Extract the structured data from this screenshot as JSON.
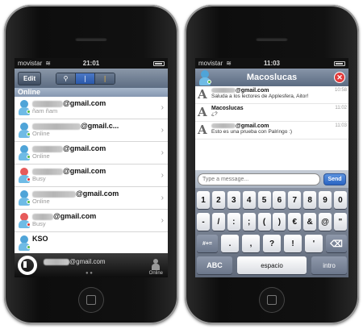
{
  "left": {
    "status": {
      "carrier": "movistar",
      "time": "21:01"
    },
    "toolbar": {
      "edit_label": "Edit"
    },
    "section_label": "Online",
    "contacts": [
      {
        "email": "@gmail.com",
        "status": "ñam ñam"
      },
      {
        "email": "@gmail.c...",
        "status": "Online"
      },
      {
        "email": "@gmail.com",
        "status": "Online"
      },
      {
        "email": "@gmail.com",
        "status": "Busy"
      },
      {
        "email": "@gmail.com",
        "status": "Online"
      },
      {
        "email": "@gmail.com",
        "status": "Busy"
      },
      {
        "email": "KSO",
        "status": ""
      }
    ],
    "bottom": {
      "email": "@gmail.com",
      "status": "Online"
    }
  },
  "right": {
    "status": {
      "carrier": "movistar",
      "time": "11:03"
    },
    "header": {
      "title": "Macoslucas",
      "close": "✕"
    },
    "messages": [
      {
        "from": "@gmail.com",
        "text": "Saluda a los lectores de Applesfera, Aitor!",
        "time": "10:58"
      },
      {
        "from": "Macoslucas",
        "text": "¿?",
        "time": "11:02"
      },
      {
        "from": "@gmail.com",
        "text": "Esto es una prueba con Palringo :)",
        "time": "11:03"
      }
    ],
    "input": {
      "placeholder": "Type a message...",
      "send_label": "Send"
    },
    "keyboard": {
      "row1": [
        "1",
        "2",
        "3",
        "4",
        "5",
        "6",
        "7",
        "8",
        "9",
        "0"
      ],
      "row2": [
        "-",
        "/",
        ":",
        ";",
        "(",
        ")",
        "€",
        "&",
        "@",
        "\""
      ],
      "row3_left": "#+=",
      "row3": [
        ".",
        ",",
        "?",
        "!",
        "'"
      ],
      "row3_right": "⌫",
      "abc": "ABC",
      "space": "espacio",
      "intro": "intro"
    }
  }
}
